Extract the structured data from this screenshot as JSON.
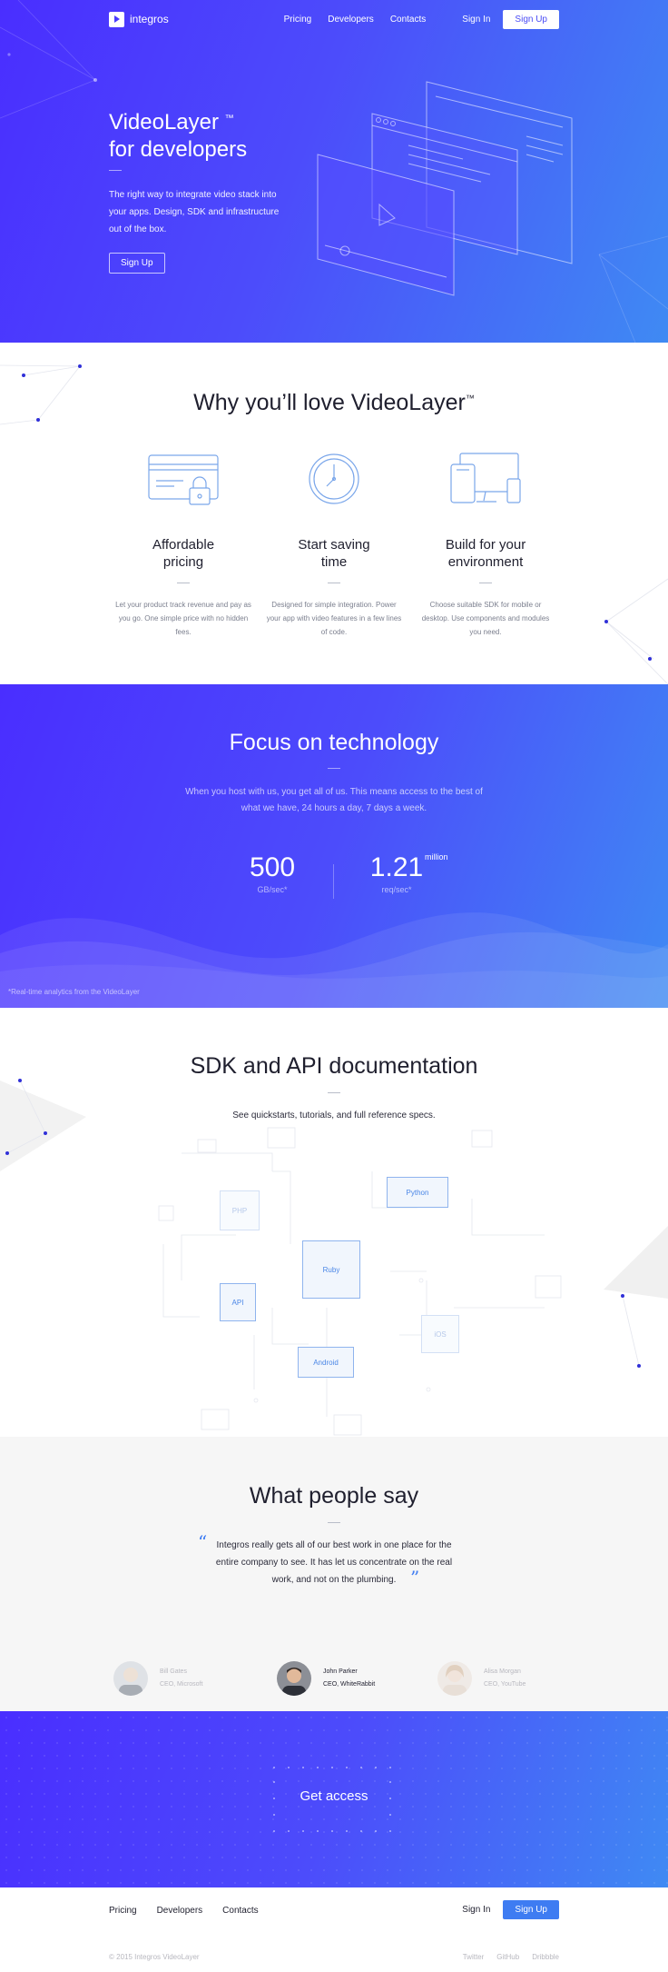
{
  "nav": {
    "brand": "integros",
    "links": [
      "Pricing",
      "Developers",
      "Contacts"
    ],
    "signin": "Sign In",
    "signup": "Sign Up"
  },
  "hero": {
    "title_line1": "VideoLayer",
    "tm": "™",
    "title_line2": "for developers",
    "text": "The right way to integrate video stack into your apps. Design, SDK and infrastructure out of the box.",
    "cta": "Sign Up"
  },
  "features": {
    "title": "Why you’ll love VideoLayer",
    "tm": "™",
    "items": [
      {
        "title_1": "Affordable",
        "title_2": "pricing",
        "text": "Let your product track revenue and pay as you go. One simple price with no hidden fees.",
        "icon": "credit-card-icon"
      },
      {
        "title_1": "Start saving",
        "title_2": "time",
        "text": "Designed for simple integration. Power your app with video features in a few lines of code.",
        "icon": "clock-icon"
      },
      {
        "title_1": "Build for your",
        "title_2": "environment",
        "text": "Choose suitable SDK for mobile or desktop. Use components and modules you need.",
        "icon": "devices-icon"
      }
    ]
  },
  "tech": {
    "title": "Focus on technology",
    "text": "When you host with us, you get all of us. This means access to the best of what we have, 24 hours a day, 7 days a week.",
    "stat1_value": "500",
    "stat1_unit": "GB/sec*",
    "stat2_value": "1.21",
    "stat2_sup": "million",
    "stat2_unit": "req/sec*",
    "note": "*Real-time analytics from the VideoLayer"
  },
  "sdk": {
    "title": "SDK and API documentation",
    "text": "See quickstarts, tutorials, and full reference specs.",
    "chips": [
      "PHP",
      "Python",
      "Ruby",
      "API",
      "iOS",
      "Android"
    ]
  },
  "testimonials": {
    "title": "What people say",
    "quote": "Integros really gets all of our best work in one place for the entire company to see. It has let us concentrate on the real work, and not on the plumbing.",
    "people": [
      {
        "name": "Bill Gates",
        "role": "CEO, Microsoft"
      },
      {
        "name": "John Parker",
        "role": "CEO, WhiteRabbit"
      },
      {
        "name": "Alisa Morgan",
        "role": "CEO, YouTube"
      }
    ]
  },
  "access": {
    "title": "Get access"
  },
  "footer": {
    "links": [
      "Pricing",
      "Developers",
      "Contacts"
    ],
    "signin": "Sign In",
    "signup": "Sign Up",
    "copyright": "© 2015 Integros VideoLayer",
    "social": [
      "Twitter",
      "GitHub",
      "Dribbble"
    ]
  },
  "colors": {
    "accent": "#3e7cf2",
    "gradient_start": "#4a2eff",
    "gradient_end": "#3f8af3"
  }
}
